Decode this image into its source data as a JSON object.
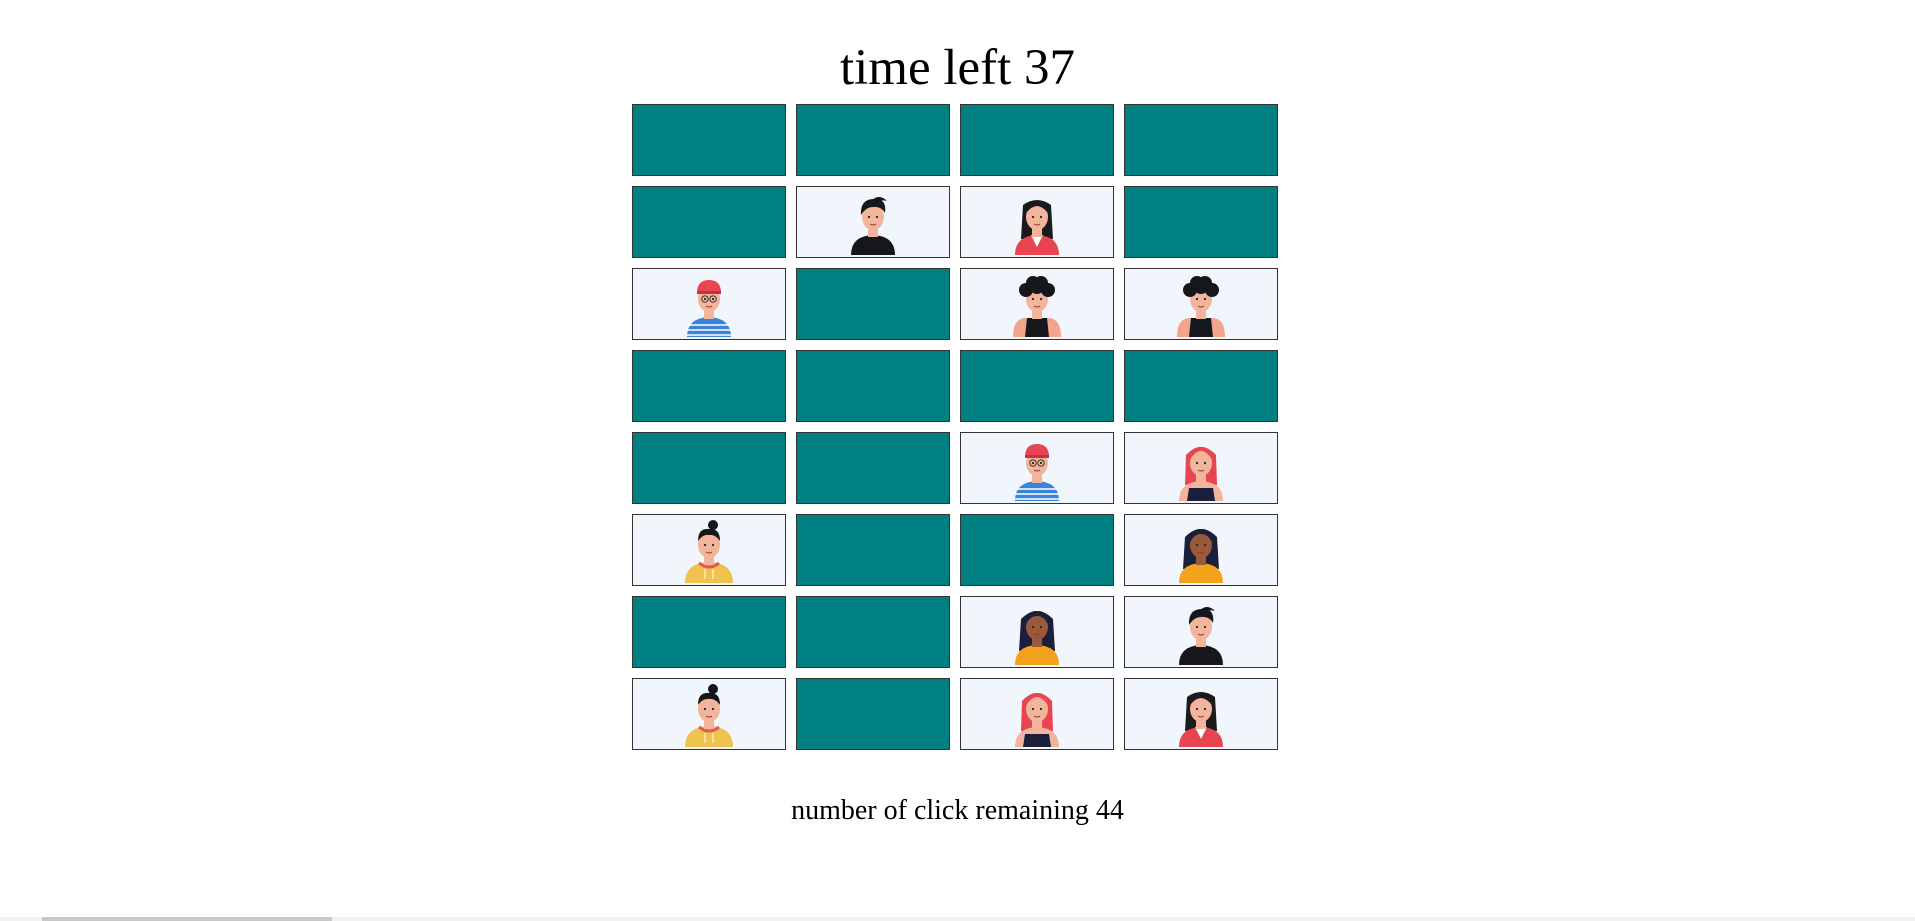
{
  "header": {
    "time_left": "time left 37"
  },
  "footer": {
    "clicks_remaining": "number of click remaining 44"
  },
  "colors": {
    "hidden_card": "#008080",
    "revealed_card": "#f0f6fc",
    "card_border": "#333333"
  },
  "board": {
    "columns": 4,
    "cards": [
      {
        "state": "hidden"
      },
      {
        "state": "hidden"
      },
      {
        "state": "hidden"
      },
      {
        "state": "hidden"
      },
      {
        "state": "hidden"
      },
      {
        "state": "revealed",
        "avatar": "man-black-shirt-icon"
      },
      {
        "state": "revealed",
        "avatar": "woman-red-top-icon"
      },
      {
        "state": "hidden"
      },
      {
        "state": "revealed",
        "avatar": "man-red-cap-striped-shirt-icon"
      },
      {
        "state": "hidden"
      },
      {
        "state": "revealed",
        "avatar": "man-afro-black-tank-icon"
      },
      {
        "state": "revealed",
        "avatar": "man-afro-black-tank-icon"
      },
      {
        "state": "hidden"
      },
      {
        "state": "hidden"
      },
      {
        "state": "hidden"
      },
      {
        "state": "hidden"
      },
      {
        "state": "hidden"
      },
      {
        "state": "hidden"
      },
      {
        "state": "revealed",
        "avatar": "man-red-cap-striped-shirt-icon"
      },
      {
        "state": "revealed",
        "avatar": "woman-pink-hair-icon"
      },
      {
        "state": "revealed",
        "avatar": "man-yellow-hoodie-icon"
      },
      {
        "state": "hidden"
      },
      {
        "state": "hidden"
      },
      {
        "state": "revealed",
        "avatar": "woman-orange-top-icon"
      },
      {
        "state": "hidden"
      },
      {
        "state": "hidden"
      },
      {
        "state": "revealed",
        "avatar": "woman-orange-top-icon"
      },
      {
        "state": "revealed",
        "avatar": "man-black-shirt-icon"
      },
      {
        "state": "revealed",
        "avatar": "man-yellow-hoodie-icon"
      },
      {
        "state": "hidden"
      },
      {
        "state": "revealed",
        "avatar": "woman-pink-hair-icon"
      },
      {
        "state": "revealed",
        "avatar": "woman-red-top-icon"
      }
    ]
  }
}
